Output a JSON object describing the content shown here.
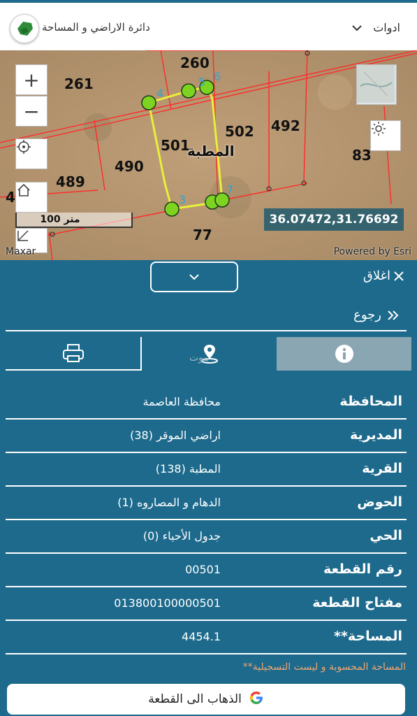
{
  "header": {
    "brand_title": "دائرة الاراضي و المساحة",
    "tools_label": "ادوات",
    "logo_icon": "jordan-map-logo-icon",
    "tools_icon": "chevron-down-icon"
  },
  "map": {
    "parcel_labels": [
      "260",
      "261",
      "502",
      "492",
      "501",
      "490",
      "489",
      "83",
      "77",
      "4"
    ],
    "place_name": "المطبة",
    "vertex_labels": [
      "4",
      "5",
      "6",
      "3",
      "7"
    ],
    "scale_label": "100 متر",
    "coordinates": "36.07472,31.76692",
    "attribution_left": "Maxar",
    "attribution_right": "Powered by Esri",
    "controls": {
      "zoom_in": "+",
      "zoom_out": "−"
    }
  },
  "panel": {
    "close_label": "اغلاق",
    "back_label": "رجوع",
    "tabs": [
      {
        "name": "info",
        "icon": "info-icon",
        "active": true
      },
      {
        "name": "my-home",
        "icon": "location-home-icon",
        "active": false
      },
      {
        "name": "print",
        "icon": "printer-icon",
        "active": false
      }
    ],
    "tab_watermark": "بيوت",
    "rows": [
      {
        "label": "المحافظة",
        "value": "محافظة العاصمة"
      },
      {
        "label": "المديرية",
        "value": "اراضي الموقر (38)"
      },
      {
        "label": "القرية",
        "value": "المطبة (138)"
      },
      {
        "label": "الحوض",
        "value": "الدهام و المصاروه (1)"
      },
      {
        "label": "الحي",
        "value": "جدول الأحياء (0)"
      },
      {
        "label": "رقم القطعة",
        "value": "00501"
      },
      {
        "label": "مفتاح القطعة",
        "value": "013800100000501"
      },
      {
        "label": "**المساحة",
        "value": "4454.1"
      }
    ],
    "footnote": "**المساحة المحسوبة و ليست التسجيلية",
    "goto_button": "الذهاب الى القطعة"
  },
  "colors": {
    "primary": "#1d6a8c",
    "active_tab": "#8aa6b2",
    "footnote": "#f0a672",
    "parcel_outline": "#ff2a2a",
    "selected_outline": "#e8f03a",
    "vertex_fill": "#7ed321"
  }
}
